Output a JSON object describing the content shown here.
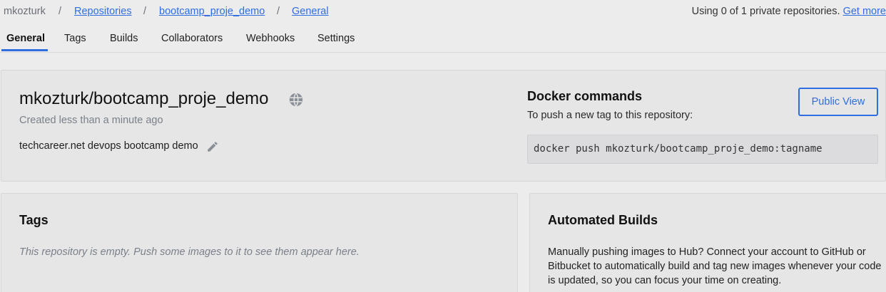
{
  "breadcrumb": {
    "user": "mkozturk",
    "sep": "/",
    "repositories": "Repositories",
    "repo": "bootcamp_proje_demo",
    "current": "General"
  },
  "usage": {
    "text": "Using 0 of 1 private repositories.",
    "link": "Get more"
  },
  "tabs": [
    {
      "label": "General",
      "active": true
    },
    {
      "label": "Tags"
    },
    {
      "label": "Builds"
    },
    {
      "label": "Collaborators"
    },
    {
      "label": "Webhooks"
    },
    {
      "label": "Settings"
    }
  ],
  "repo": {
    "title": "mkozturk/bootcamp_proje_demo",
    "visibility_icon": "globe-icon",
    "created": "Created less than a minute ago",
    "description": "techcareer.net devops bootcamp demo",
    "edit_icon": "pencil-icon"
  },
  "docker": {
    "heading": "Docker commands",
    "subtitle": "To push a new tag to this repository:",
    "command": "docker push mkozturk/bootcamp_proje_demo:tagname",
    "public_view": "Public View"
  },
  "tags": {
    "heading": "Tags",
    "empty": "This repository is empty. Push some images to it to see them appear here."
  },
  "automated_builds": {
    "heading": "Automated Builds",
    "text": "Manually pushing images to Hub? Connect your account to GitHub or Bitbucket to automatically build and tag new images whenever your code is updated, so you can focus your time on creating."
  },
  "colors": {
    "accent": "#2f6de1",
    "muted_text": "#7a8089",
    "panel_bg": "#e6e6e6",
    "page_bg": "#ececec"
  }
}
